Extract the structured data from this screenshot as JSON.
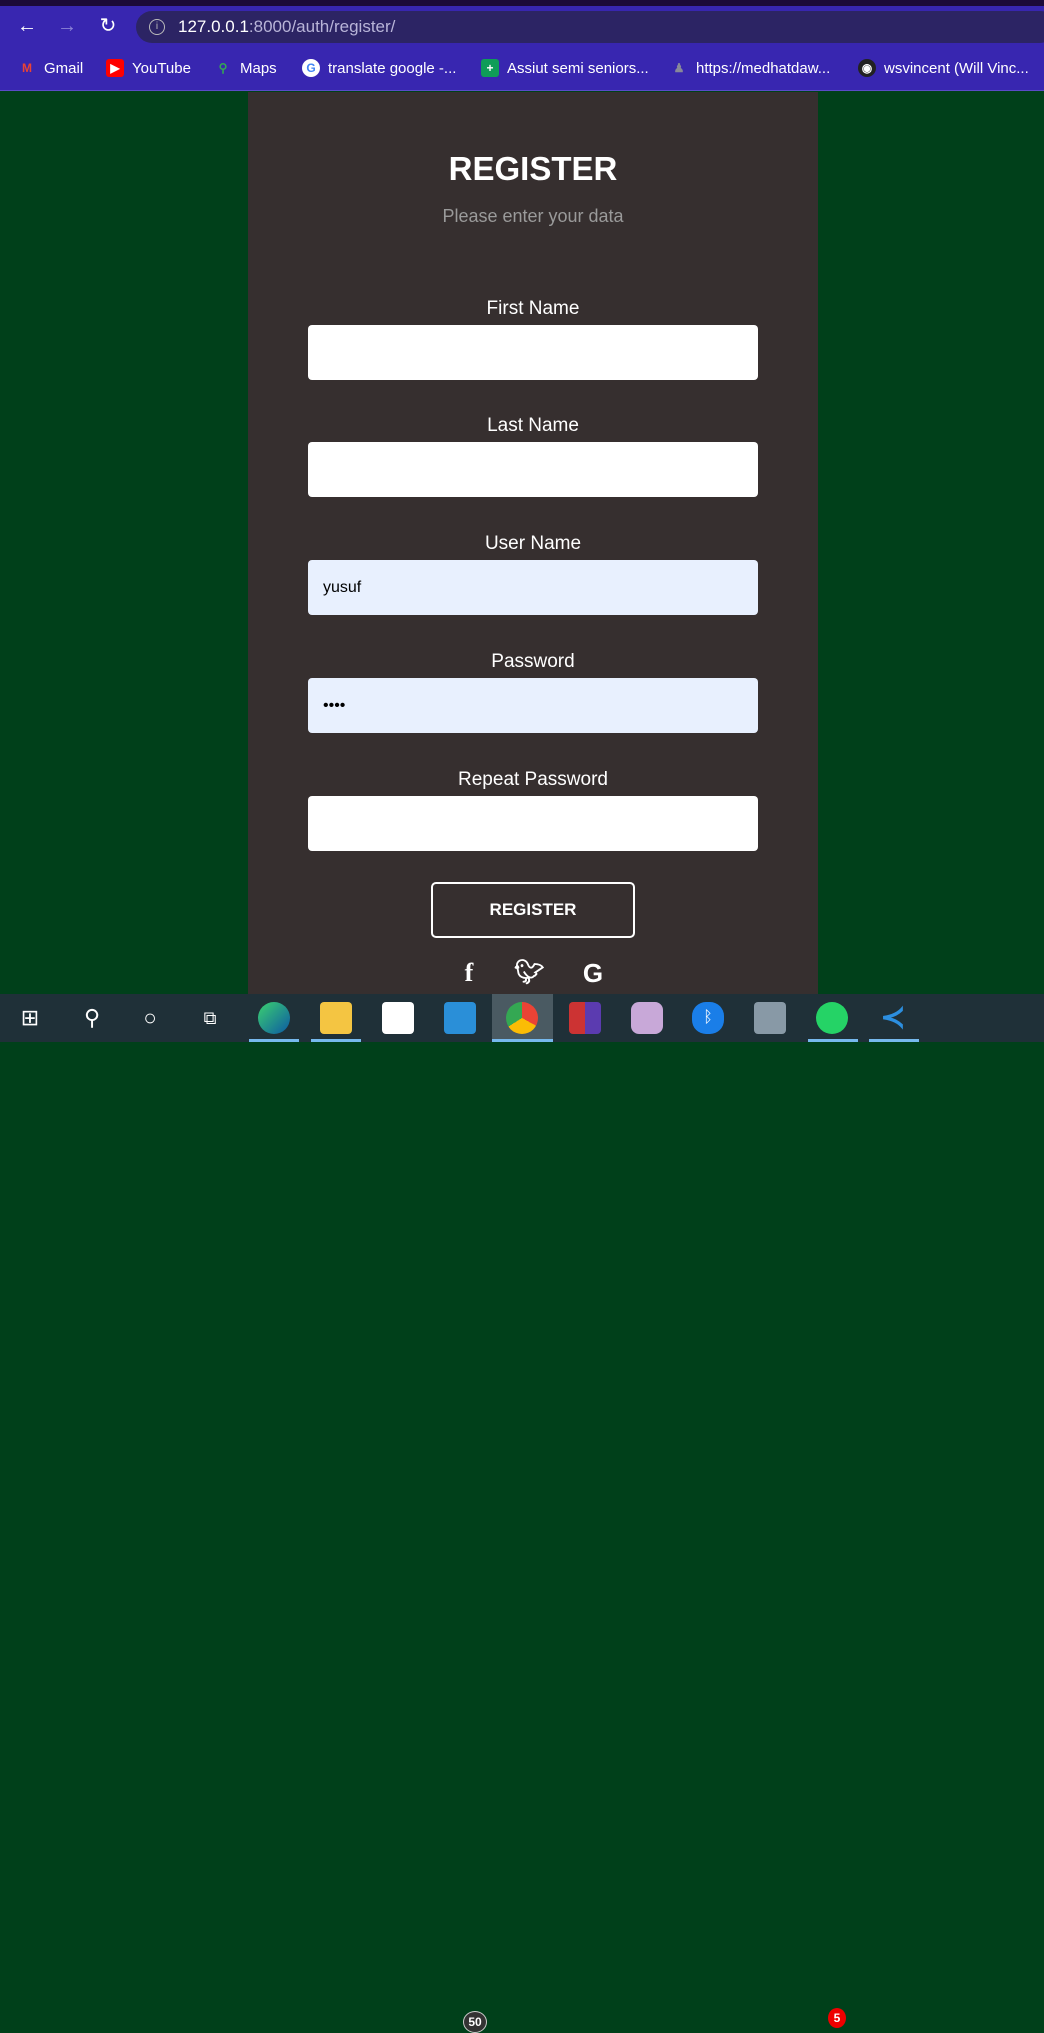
{
  "browser": {
    "url_host": "127.0.0.1",
    "url_rest": ":8000/auth/register/",
    "bookmarks": [
      "Gmail",
      "YouTube",
      "Maps",
      "translate google -...",
      "Assiut semi seniors...",
      "https://medhatdaw...",
      "wsvincent (Will Vinc..."
    ]
  },
  "form": {
    "title": "REGISTER",
    "subtitle": "Please enter your data",
    "fields": [
      {
        "label": "First Name",
        "value": ""
      },
      {
        "label": "Last Name",
        "value": ""
      },
      {
        "label": "User Name",
        "value": "yusuf"
      },
      {
        "label": "Password",
        "value": "••••"
      },
      {
        "label": "Repeat Password",
        "value": ""
      }
    ],
    "submit": "REGISTER",
    "social": [
      "facebook-icon",
      "twitter-icon",
      "google-icon"
    ]
  },
  "taskbar": {
    "mail_badge": "50",
    "whatsapp_badge": "5"
  },
  "colors": {
    "page_bg": "#00401a",
    "panel_bg": "#362f2f",
    "browser_bar": "#3826b0"
  }
}
